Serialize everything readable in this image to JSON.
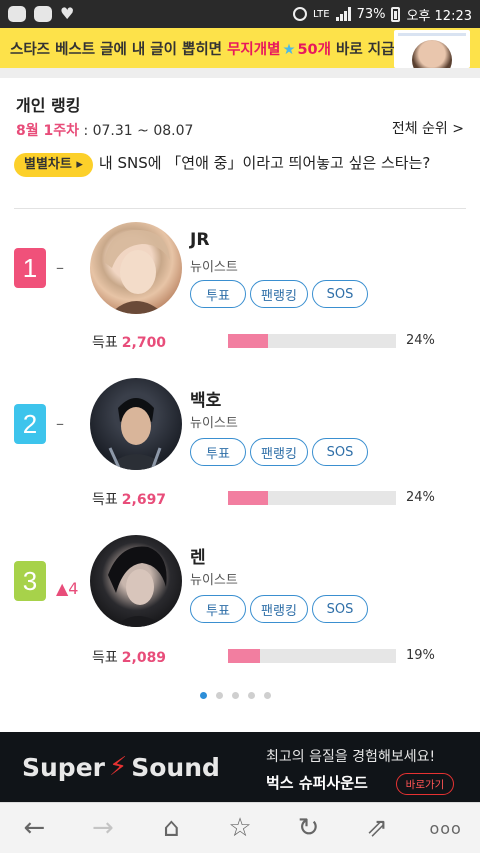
{
  "status_bar": {
    "battery": "73%",
    "time": "오후 12:23",
    "network": "LTE",
    "dots": "..."
  },
  "top_banner": {
    "text_before": "스타즈 베스트 글에 내 글이 뽑히면 ",
    "highlight": "무지개별",
    "count": "50개",
    "text_after": " 바로 지급!"
  },
  "ranking": {
    "title": "개인 랭킹",
    "week_label": "8월 1주차",
    "date_range": " : 07.31 ~ 08.07",
    "all_rank_link": "전체 순위 >",
    "chart_chip": "별별차트 ▸",
    "question": "내 SNS에 「연애 중」이라고 띄어놓고 싶은 스타는?",
    "vote_label": "득표",
    "button_vote": "투표",
    "button_fanrank": "팬랭킹",
    "button_sos": "SOS",
    "items": [
      {
        "rank": "1",
        "change": "–",
        "name": "JR",
        "group": "뉴이스트",
        "votes": "2,700",
        "pct": "24%",
        "share": 0.24,
        "rank_color": "#f0517a"
      },
      {
        "rank": "2",
        "change": "–",
        "name": "백호",
        "group": "뉴이스트",
        "votes": "2,697",
        "pct": "24%",
        "share": 0.24,
        "rank_color": "#3dc4ec"
      },
      {
        "rank": "3",
        "change": "▲4",
        "name": "렌",
        "group": "뉴이스트",
        "votes": "2,089",
        "pct": "19%",
        "share": 0.19,
        "rank_color": "#a7d24a"
      }
    ]
  },
  "pager": {
    "count": 5,
    "active": 0
  },
  "ad": {
    "logo_left": "Super",
    "logo_right": "Sound",
    "line1": "최고의 음질을 경험해보세요!",
    "line2": "벅스 슈퍼사운드",
    "cta": "바로가기"
  },
  "toolbar": {
    "back": "←",
    "forward": "→",
    "home": "⌂",
    "bookmark": "☆",
    "refresh": "↻",
    "share": "⇗",
    "more": "ooo"
  }
}
